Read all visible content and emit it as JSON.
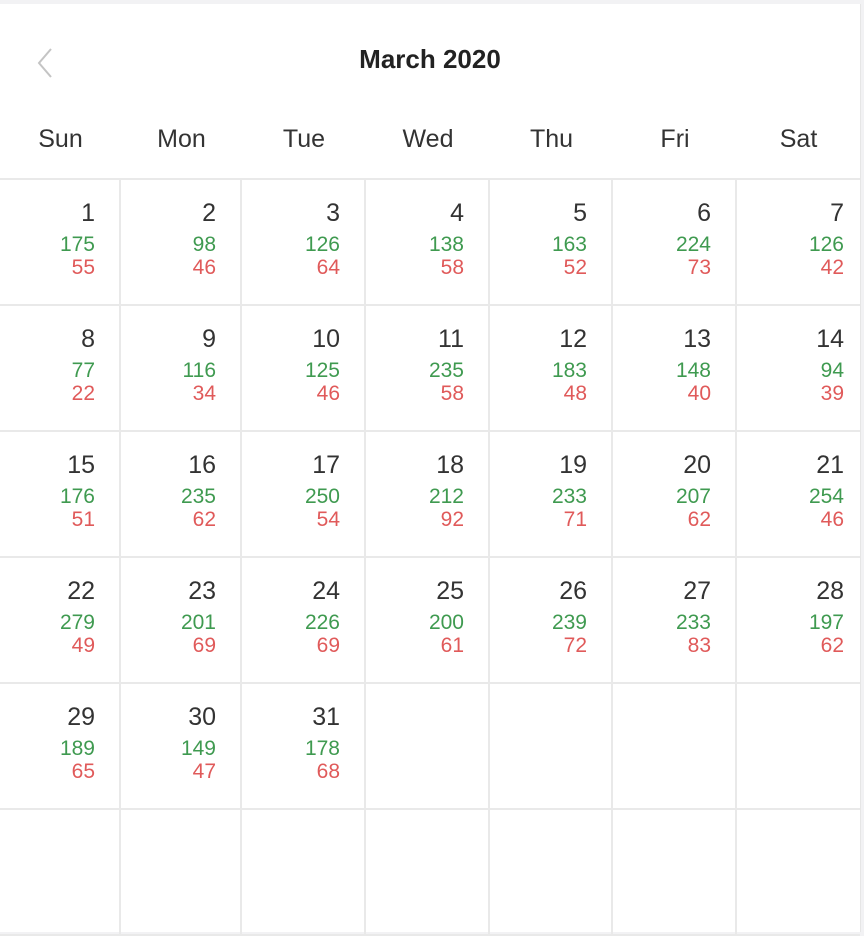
{
  "header": {
    "title": "March 2020",
    "prev_icon": "chevron-left-icon"
  },
  "weekdays": [
    "Sun",
    "Mon",
    "Tue",
    "Wed",
    "Thu",
    "Fri",
    "Sat"
  ],
  "colors": {
    "positive": "#3f9a50",
    "negative": "#e05a5a"
  },
  "days": [
    {
      "day": "1",
      "green": "175",
      "red": "55"
    },
    {
      "day": "2",
      "green": "98",
      "red": "46"
    },
    {
      "day": "3",
      "green": "126",
      "red": "64"
    },
    {
      "day": "4",
      "green": "138",
      "red": "58"
    },
    {
      "day": "5",
      "green": "163",
      "red": "52"
    },
    {
      "day": "6",
      "green": "224",
      "red": "73"
    },
    {
      "day": "7",
      "green": "126",
      "red": "42"
    },
    {
      "day": "8",
      "green": "77",
      "red": "22"
    },
    {
      "day": "9",
      "green": "116",
      "red": "34"
    },
    {
      "day": "10",
      "green": "125",
      "red": "46"
    },
    {
      "day": "11",
      "green": "235",
      "red": "58"
    },
    {
      "day": "12",
      "green": "183",
      "red": "48"
    },
    {
      "day": "13",
      "green": "148",
      "red": "40"
    },
    {
      "day": "14",
      "green": "94",
      "red": "39"
    },
    {
      "day": "15",
      "green": "176",
      "red": "51"
    },
    {
      "day": "16",
      "green": "235",
      "red": "62"
    },
    {
      "day": "17",
      "green": "250",
      "red": "54"
    },
    {
      "day": "18",
      "green": "212",
      "red": "92"
    },
    {
      "day": "19",
      "green": "233",
      "red": "71"
    },
    {
      "day": "20",
      "green": "207",
      "red": "62"
    },
    {
      "day": "21",
      "green": "254",
      "red": "46"
    },
    {
      "day": "22",
      "green": "279",
      "red": "49"
    },
    {
      "day": "23",
      "green": "201",
      "red": "69"
    },
    {
      "day": "24",
      "green": "226",
      "red": "69"
    },
    {
      "day": "25",
      "green": "200",
      "red": "61"
    },
    {
      "day": "26",
      "green": "239",
      "red": "72"
    },
    {
      "day": "27",
      "green": "233",
      "red": "83"
    },
    {
      "day": "28",
      "green": "197",
      "red": "62"
    },
    {
      "day": "29",
      "green": "189",
      "red": "65"
    },
    {
      "day": "30",
      "green": "149",
      "red": "47"
    },
    {
      "day": "31",
      "green": "178",
      "red": "68"
    }
  ]
}
